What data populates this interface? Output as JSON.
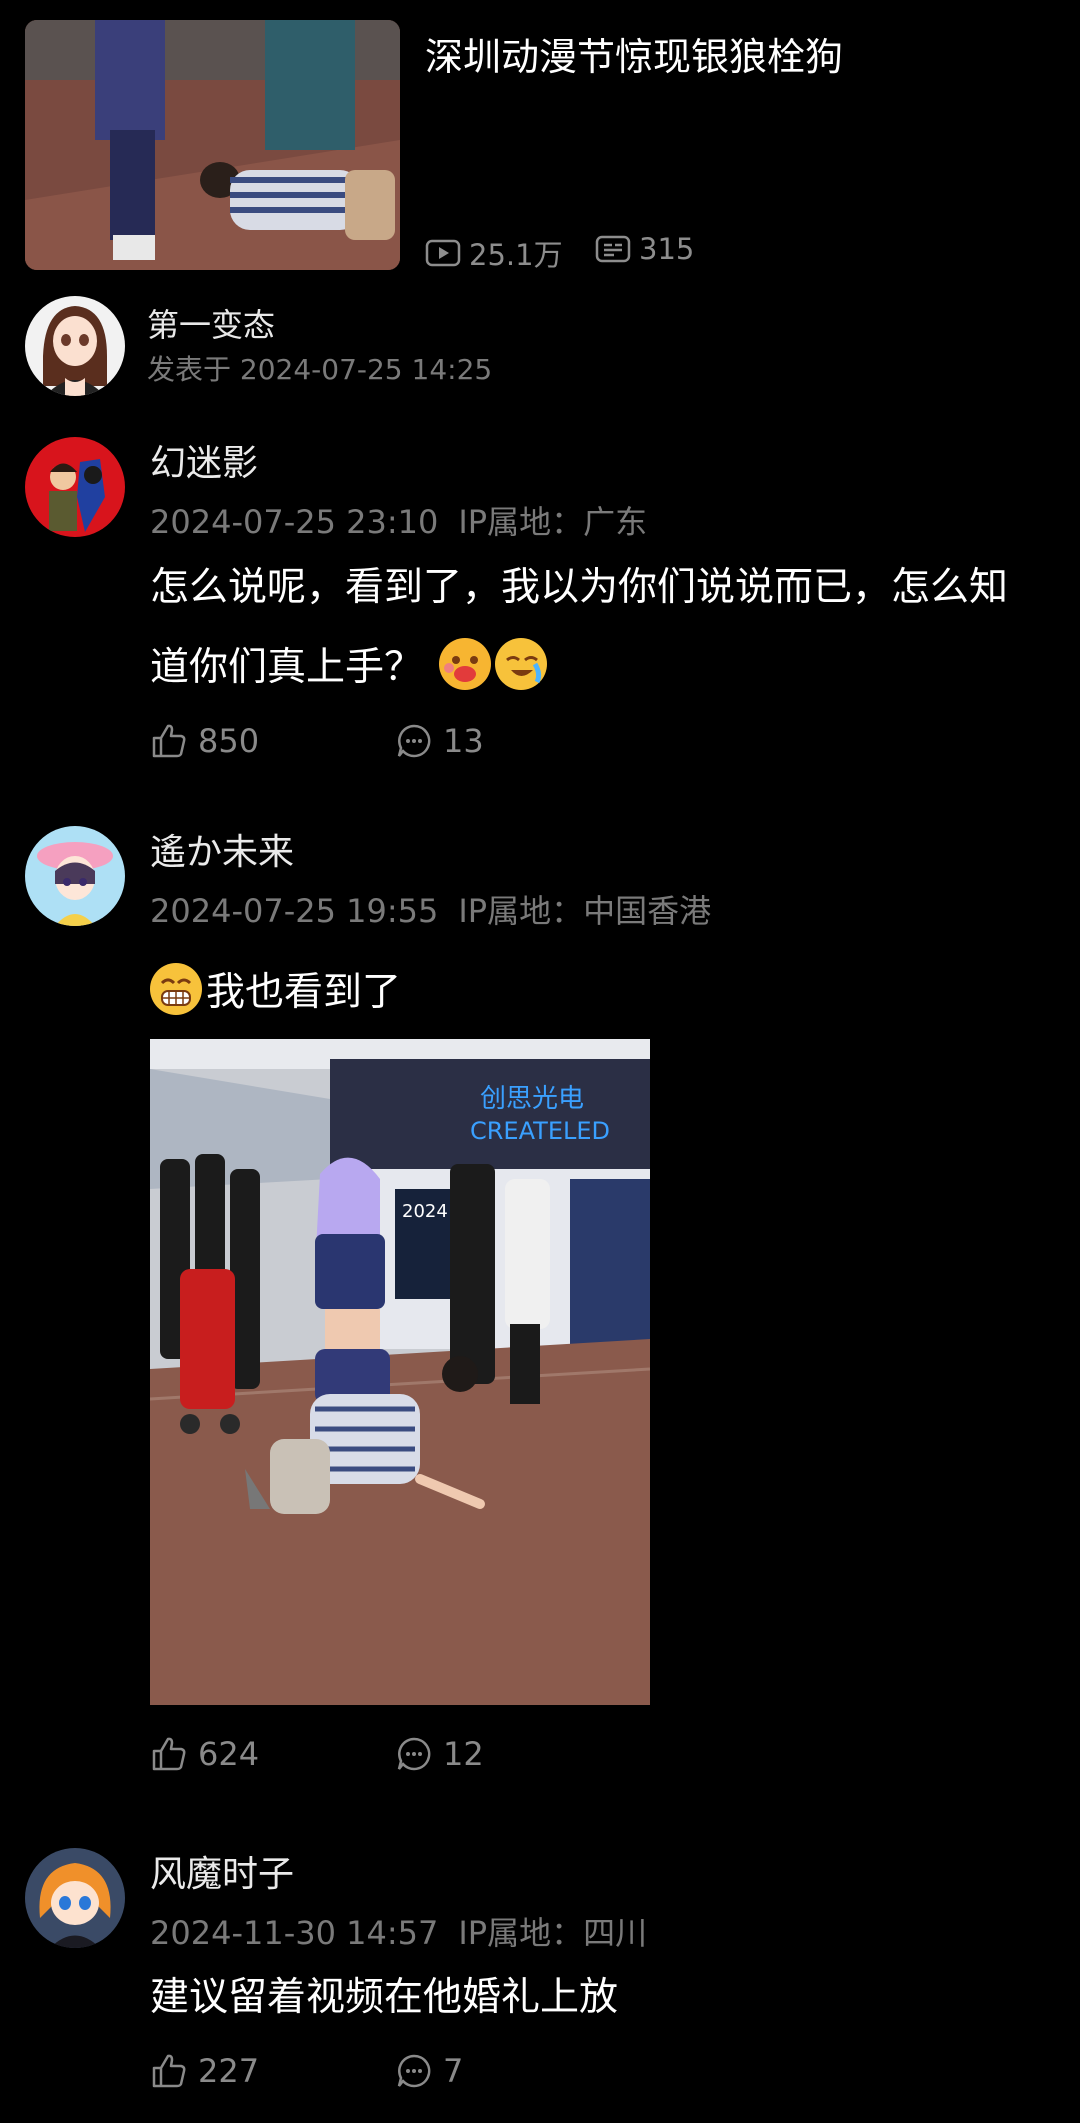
{
  "video": {
    "title": "深圳动漫节惊现银狼栓狗",
    "views": "25.1万",
    "danmaku": "315"
  },
  "post": {
    "author": "第一变态",
    "posted_at": "发表于 2024-07-25 14:25"
  },
  "comments": [
    {
      "name": "幻迷影",
      "time": "2024-07-25 23:10",
      "ip": "IP属地：广东",
      "text_line1": "怎么说呢，看到了，我以为你们说说而已，怎么知",
      "text_line2": "道你们真上手？",
      "likes": "850",
      "replies": "13"
    },
    {
      "name": "遙か未来",
      "time": "2024-07-25 19:55",
      "ip": "IP属地：中国香港",
      "text": "我也看到了",
      "likes": "624",
      "replies": "12"
    },
    {
      "name": "风魔时子",
      "time": "2024-11-30 14:57",
      "ip": "IP属地：四川",
      "text": "建议留着视频在他婚礼上放",
      "likes": "227",
      "replies": "7"
    }
  ],
  "photo_sign": {
    "line1": "创思光电",
    "line2": "CREATELED",
    "year": "2024"
  },
  "icons": [
    "play-icon",
    "danmaku-icon",
    "thumbs-up-icon",
    "comment-icon",
    "emoji-icon"
  ],
  "colors": {
    "background": "#000000",
    "meta_text": "#7a7a7a",
    "sign_blue": "#3aa0ff"
  }
}
